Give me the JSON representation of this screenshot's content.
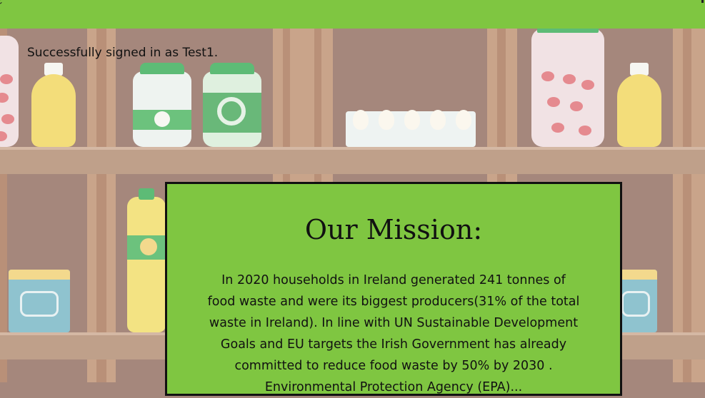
{
  "status": {
    "signed_in_message": "Successfully signed in as Test1."
  },
  "mission": {
    "title": "Our Mission:",
    "body": "In 2020 households in Ireland generated 241 tonnes of food waste and were its biggest producers(31% of the total waste in Ireland). In line with UN Sustainable Development Goals and EU targets the Irish Government has already committed to reduce food waste by 50% by 2030 . Environmental Protection Agency (EPA)..."
  },
  "colors": {
    "nav_green": "#7fc641",
    "card_green": "#7fc641",
    "pantry_background": "#a5877c",
    "text": "#111111"
  },
  "background_scene": {
    "type": "pantry-shelves-illustration",
    "icons": [
      "oil-bottle-icon",
      "mushroom-jar-icon",
      "pickle-jar-icon",
      "egg-carton-icon",
      "tomato-jar-icon",
      "tin-can-icon",
      "soda-bottle-icon"
    ]
  }
}
